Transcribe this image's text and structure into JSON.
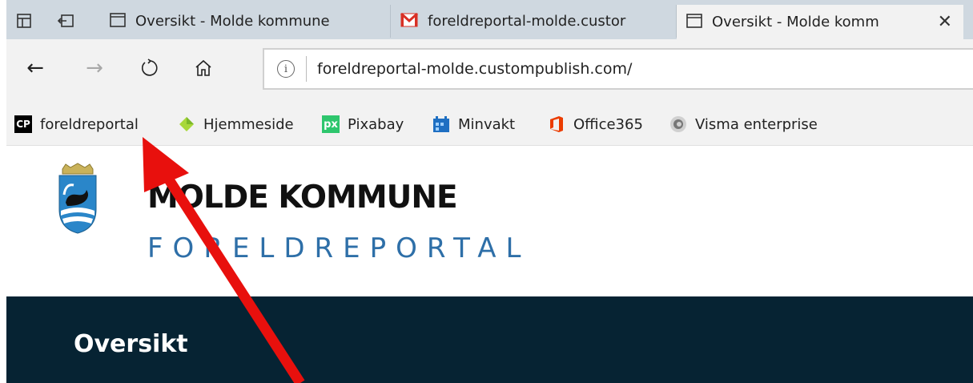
{
  "tabs": [
    {
      "title": "Oversikt - Molde kommune",
      "icon": "page-icon",
      "active": false
    },
    {
      "title": "foreldreportal-molde.custor",
      "icon": "gmail-icon",
      "active": false
    },
    {
      "title": "Oversikt - Molde komm",
      "icon": "page-icon",
      "active": true
    }
  ],
  "address": {
    "url": "foreldreportal-molde.custompublish.com/"
  },
  "favorites": [
    {
      "label": "foreldreportal",
      "icon": "cp-icon"
    },
    {
      "label": "Hjemmeside",
      "icon": "diamond-icon"
    },
    {
      "label": "Pixabay",
      "icon": "pixabay-icon"
    },
    {
      "label": "Minvakt",
      "icon": "minvakt-icon"
    },
    {
      "label": "Office365",
      "icon": "office-icon"
    },
    {
      "label": "Visma enterprise",
      "icon": "visma-icon"
    }
  ],
  "page": {
    "brand_title": "MOLDE KOMMUNE",
    "brand_subtitle": "FORELDREPORTAL",
    "heading": "Oversikt"
  },
  "icons": {
    "fav_cp": "CP",
    "fav_pixabay": "px"
  },
  "colors": {
    "tabbar": "#cfd8e0",
    "toolbar": "#f2f2f2",
    "band": "#062333",
    "arrow": "#e8100d",
    "subtitle": "#2e6fa8"
  }
}
